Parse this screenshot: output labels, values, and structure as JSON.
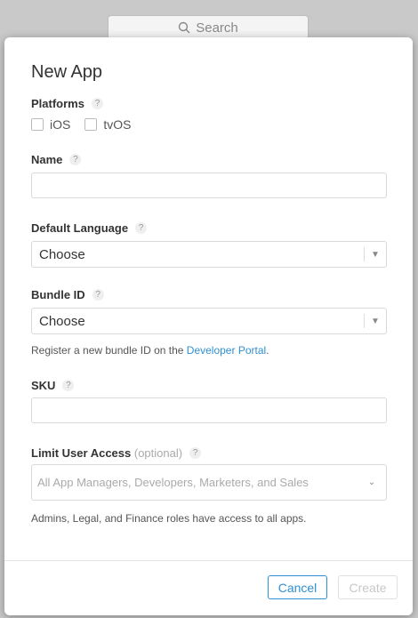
{
  "background": {
    "search_placeholder": "Search"
  },
  "modal": {
    "title": "New App",
    "platforms": {
      "label": "Platforms",
      "help": "?",
      "options": [
        "iOS",
        "tvOS"
      ]
    },
    "name": {
      "label": "Name",
      "help": "?",
      "value": ""
    },
    "default_language": {
      "label": "Default Language",
      "help": "?",
      "value": "Choose"
    },
    "bundle_id": {
      "label": "Bundle ID",
      "help": "?",
      "value": "Choose",
      "hint_prefix": "Register a new bundle ID on the ",
      "hint_link": "Developer Portal",
      "hint_suffix": "."
    },
    "sku": {
      "label": "SKU",
      "help": "?",
      "value": ""
    },
    "limit_user_access": {
      "label": "Limit User Access",
      "optional": "(optional)",
      "help": "?",
      "placeholder": "All App Managers, Developers, Marketers, and Sales",
      "hint": "Admins, Legal, and Finance roles have access to all apps."
    },
    "buttons": {
      "cancel": "Cancel",
      "create": "Create"
    }
  },
  "colors": {
    "link": "#2f8fd1",
    "disabled": "#c8c8c8"
  }
}
